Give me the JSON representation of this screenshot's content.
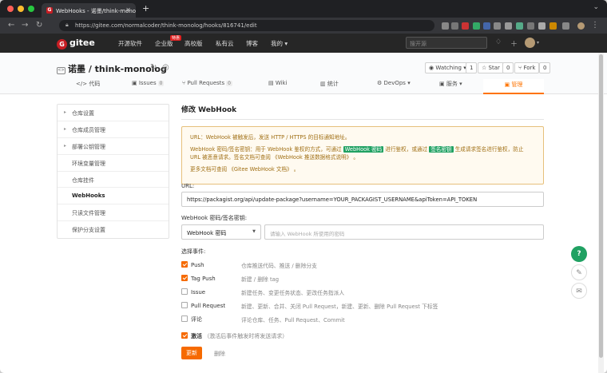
{
  "browser": {
    "tab_title": "WebHooks - 诺墨/think-monolog",
    "favicon_letter": "G",
    "url": "https://gitee.com/normalcoder/think-monolog/hooks/816741/edit"
  },
  "header": {
    "logo": "gitee",
    "logo_letter": "G",
    "nav": [
      "开源软件",
      "企业版",
      "高校版",
      "私有云",
      "博客",
      "我的"
    ],
    "badge": "特惠",
    "search_placeholder": "搜开源"
  },
  "repo": {
    "title": "诺墨 / think-monolog",
    "watch_label": "Watching",
    "watch_count": "1",
    "star_label": "Star",
    "star_count": "0",
    "fork_label": "Fork",
    "fork_count": "0",
    "tabs": [
      {
        "label": "代码"
      },
      {
        "label": "Issues",
        "count": "0"
      },
      {
        "label": "Pull Requests",
        "count": "0"
      },
      {
        "label": "Wiki"
      },
      {
        "label": "统计"
      },
      {
        "label": "DevOps"
      },
      {
        "label": "服务"
      }
    ],
    "active_tab": "管理"
  },
  "sidebar": {
    "items": [
      "仓库设置",
      "仓库成员管理",
      "部署公钥管理",
      "环境变量管理",
      "仓库挂件",
      "WebHooks",
      "只读文件管理",
      "保护分支设置"
    ]
  },
  "form": {
    "title": "修改 WebHook",
    "notice_line1": "URL：WebHook 被触发后，发送 HTTP / HTTPS 的目标通知地址。",
    "notice_line2_a": "WebHook 密码/签名密钥：用于 WebHook 鉴权的方式，可通过",
    "notice_tag1": "WebHook 密码",
    "notice_line2_b": "进行鉴权，或通过",
    "notice_tag2": "签名密钥",
    "notice_line2_c": "生成请求签名进行鉴权，防止 URL 被恶意请求。签名文档可查阅 《WebHook 推送数据格式说明》 。",
    "notice_line3": "更多文档可查阅 《Gitee WebHook 文档》 。",
    "url_label": "URL:",
    "url_value": "https://packagist.org/api/update-package?username=YOUR_PACKAGIST_USERNAME&apiToken=API_TOKEN",
    "secret_label": "WebHook 密码/签名密钥:",
    "secret_type": "WebHook 密码",
    "secret_placeholder": "请输入 WebHook 所使用的密码",
    "events_label": "选择事件:",
    "events": [
      {
        "name": "Push",
        "desc": "仓库推送代码、推送 / 删除分支",
        "checked": true
      },
      {
        "name": "Tag Push",
        "desc": "新建 / 删除 tag",
        "checked": true
      },
      {
        "name": "Issue",
        "desc": "新建任务、变更任务状态、更改任务指派人",
        "checked": false
      },
      {
        "name": "Pull Request",
        "desc": "新建、更新、合并、关闭 Pull Request，新建、更新、删除 Pull Request 下标签",
        "checked": false
      },
      {
        "name": "评论",
        "desc": "评论仓库、任务、Pull Request、Commit",
        "checked": false
      }
    ],
    "activate_label": "激活",
    "activate_hint": "（激活后事件触发时将发送请求）",
    "update_button": "更新",
    "delete_button": "删除"
  },
  "colors": {
    "accent": "#f66a00",
    "brand": "#c71d23",
    "success": "#20a162"
  }
}
